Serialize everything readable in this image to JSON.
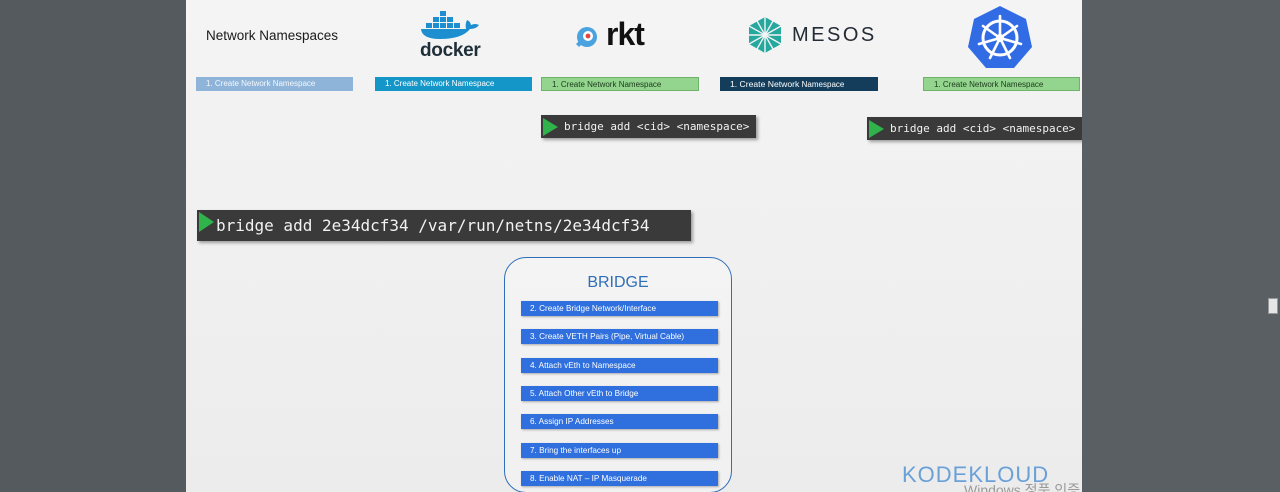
{
  "header": {
    "title": "Network Namespaces"
  },
  "logos": {
    "docker": "docker",
    "rkt": "rkt",
    "mesos": "MESOS",
    "kubernetes_icon": "kubernetes-wheel-icon"
  },
  "steps": {
    "generic": "1. Create Network Namespace",
    "docker": "1. Create Network Namespace",
    "rkt": "1. Create Network Namespace",
    "mesos_prefix": "1. Create Network ",
    "mesos_suffix": "Namespace",
    "kubernetes": "1. Create Network Namespace"
  },
  "commands": {
    "rkt": "bridge add <cid> <namespace>",
    "kubernetes": "bridge add <cid> <namespace>",
    "main": "bridge add 2e34dcf34 /var/run/netns/2e34dcf34"
  },
  "bridge": {
    "title": "BRIDGE",
    "steps": [
      "2. Create Bridge Network/Interface",
      "3. Create VETH Pairs (Pipe, Virtual Cable)",
      "4. Attach vEth to Namespace",
      "5. Attach Other vEth to Bridge",
      "6. Assign IP Addresses",
      "7. Bring the interfaces up",
      "8. Enable NAT – IP Masquerade"
    ]
  },
  "branding": {
    "kodekloud": "KODEKLOUD",
    "windows_watermark": "Windows 정품 인증"
  },
  "colors": {
    "generic_step": "#8fb4d9",
    "docker_step": "#1496c8",
    "rkt_step": "#93d48f",
    "mesos_step": "#133d5b",
    "kubernetes_step": "#93d48f",
    "bridge_step": "#2f6fde",
    "kubernetes_blue": "#326ce5",
    "play_green": "#2fb34a"
  }
}
